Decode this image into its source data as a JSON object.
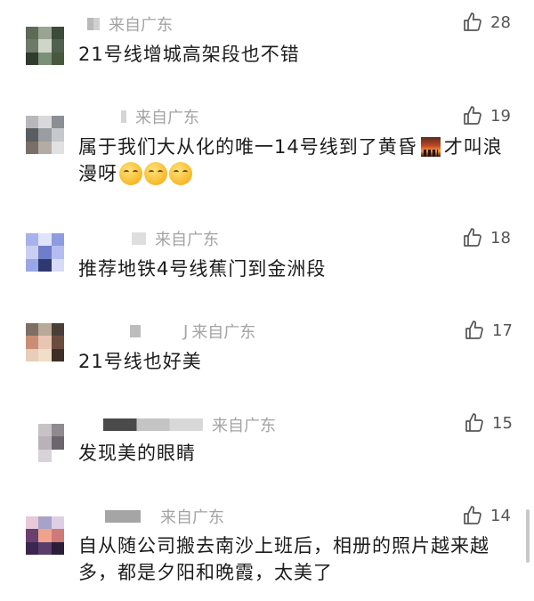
{
  "comments": [
    {
      "location": "来自广东",
      "likes": "28",
      "text": "21号线增城高架段也不错",
      "avatar_colors": [
        "#5d6a55",
        "#9aa494",
        "#3d4a3a",
        "#6c7a67",
        "#cfd5c9",
        "#50604d",
        "#2f3b2c",
        "#7c8f78",
        "#48583f"
      ],
      "name_blocks": [
        "#b9b9b9",
        "#d0d0d0"
      ]
    },
    {
      "location": "来自广东",
      "likes": "19",
      "text_before_icon": "属于我们大从化的唯一14号线到了黄昏",
      "icon_name": "sunset-emoji",
      "text_after_icon": "才叫浪漫呀",
      "emojis": [
        "smiling-face-emoji",
        "smiling-face-emoji",
        "smiling-face-emoji"
      ],
      "avatar_colors": [
        "#b6b8bc",
        "#d9d9dc",
        "#8b8f93",
        "#5a5e62",
        "#9a9da1",
        "#c6c9cc",
        "#7a6f66",
        "#b3aca4",
        "#e1e1e1"
      ],
      "name_blocks": [
        "#d5d5d5"
      ]
    },
    {
      "location": "来自广东",
      "likes": "18",
      "text": "推荐地铁4号线蕉门到金洲段",
      "avatar_colors": [
        "#a6b2e8",
        "#dfe4fb",
        "#8d9be0",
        "#c9cff3",
        "#6e7ec9",
        "#b5bdf0",
        "#9aa6e6",
        "#2f3970",
        "#d7dbf6"
      ],
      "name_blocks": [
        "#dedede"
      ]
    },
    {
      "location": "来自广东",
      "likes": "17",
      "text": "21号线也好美",
      "name_suffix": "J",
      "avatar_colors": [
        "#7d6f63",
        "#b9a999",
        "#4a3f36",
        "#c98f76",
        "#e9c5b3",
        "#6b4d3e",
        "#e8cdb8",
        "#f2ddc8",
        "#3f2e25"
      ],
      "name_blocks": [
        "#bdbdbd"
      ]
    },
    {
      "location": "来自广东",
      "likes": "15",
      "text": "发现美的眼睛",
      "avatar_colors": [
        "#ffffff",
        "#c6c2c6",
        "#8e8a8e",
        "#ffffff",
        "#b9b3b9",
        "#6d656d",
        "#ffffff",
        "#d8d3d8",
        "#ffffff"
      ],
      "name_blocks": [
        "#4a4a4a",
        "#c4c4c4",
        "#d8d8d8"
      ]
    },
    {
      "location": "来自广东",
      "likes": "14",
      "text": "自从随公司搬去南沙上班后，相册的照片越来越多，都是夕阳和晚霞，太美了",
      "avatar_colors": [
        "#e7c9d8",
        "#a7a3c8",
        "#ddd0e4",
        "#6b3f6e",
        "#f0a38c",
        "#cf7a78",
        "#3b2650",
        "#5a3d6a",
        "#2a1e38"
      ],
      "name_blocks": [
        "#a5a5a5",
        "#a5a5a5"
      ]
    }
  ]
}
